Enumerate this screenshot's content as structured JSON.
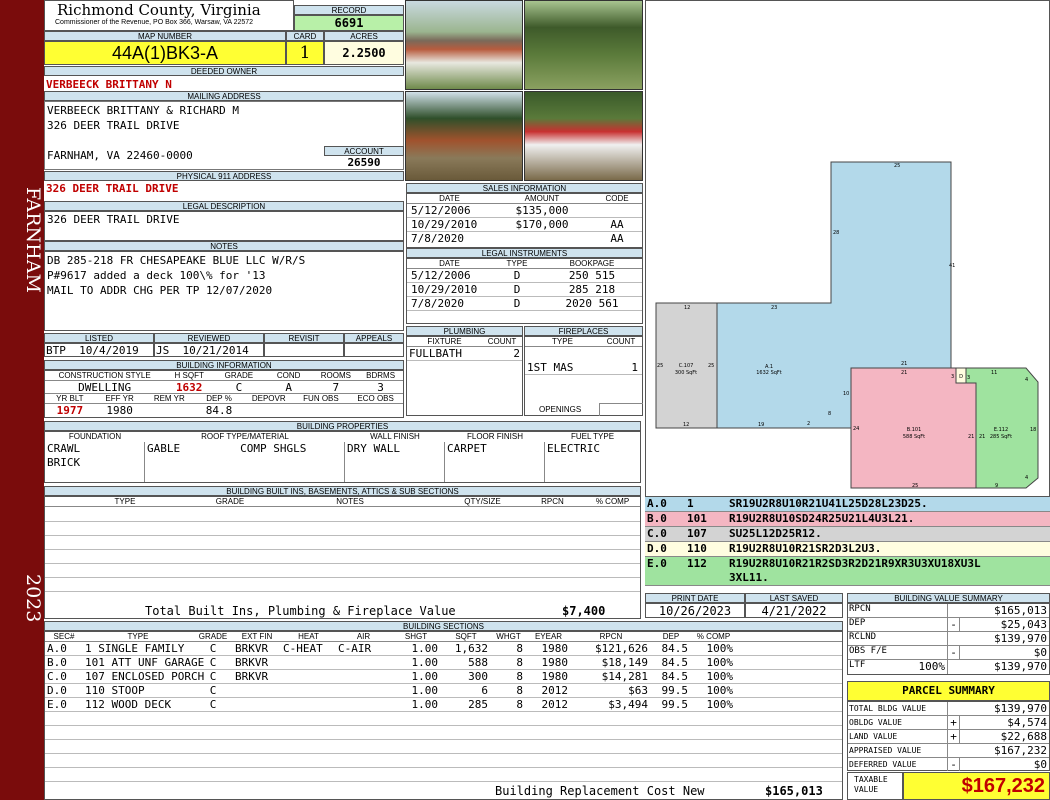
{
  "sidebar": {
    "city": "FARNHAM",
    "year": "2023"
  },
  "header": {
    "county": "Richmond County, Virginia",
    "commissioner": "Commissioner of the Revenue, PO Box 366, Warsaw, VA 22572",
    "record_label": "RECORD",
    "record": "6691",
    "map_label": "MAP NUMBER",
    "map_number": "44A(1)BK3-A",
    "card_label": "CARD",
    "card": "1",
    "acres_label": "ACRES",
    "acres": "2.2500"
  },
  "owner": {
    "deeded_label": "DEEDED OWNER",
    "deeded": "VERBEECK BRITTANY N",
    "mailing_label": "MAILING ADDRESS",
    "mail1": "VERBEECK BRITTANY & RICHARD M",
    "mail2": "326 DEER TRAIL DRIVE",
    "mail3": "FARNHAM, VA 22460-0000",
    "account_label": "ACCOUNT",
    "account": "26590",
    "physical_label": "PHYSICAL 911 ADDRESS",
    "physical": "326 DEER TRAIL DRIVE",
    "legal_label": "LEGAL DESCRIPTION",
    "legal": "326 DEER TRAIL DRIVE",
    "notes_label": "NOTES",
    "note1": "DB 285-218 FR CHESAPEAKE BLUE LLC W/R/S",
    "note2": "P#9617 added a deck 100\\% for '13",
    "note3": "MAIL TO ADDR CHG PER TP 12/07/2020"
  },
  "sales": {
    "title": "SALES INFORMATION",
    "cols": [
      "DATE",
      "AMOUNT",
      "CODE"
    ],
    "rows": [
      [
        "5/12/2006",
        "$135,000",
        ""
      ],
      [
        "10/29/2010",
        "$170,000",
        "AA"
      ],
      [
        "7/8/2020",
        "",
        "AA"
      ]
    ]
  },
  "legal_inst": {
    "title": "LEGAL INSTRUMENTS",
    "cols": [
      "DATE",
      "TYPE",
      "BOOKPAGE"
    ],
    "rows": [
      [
        "5/12/2006",
        "D",
        "250 515"
      ],
      [
        "10/29/2010",
        "D",
        "285 218"
      ],
      [
        "7/8/2020",
        "D",
        "2020 561"
      ]
    ]
  },
  "listing": {
    "listed_label": "LISTED",
    "listed_by": "BTP",
    "listed_date": "10/4/2019",
    "reviewed_label": "REVIEWED",
    "reviewed_by": "JS",
    "reviewed_date": "10/21/2014",
    "revisit_label": "REVISIT",
    "appeals_label": "APPEALS"
  },
  "bldg_info": {
    "title": "BUILDING INFORMATION",
    "h1": "CONSTRUCTION STYLE",
    "h2": "H SQFT",
    "h3": "GRADE",
    "h4": "COND",
    "h5": "ROOMS",
    "h6": "BDRMS",
    "style": "DWELLING",
    "sqft": "1632",
    "grade": "C",
    "cond": "A",
    "rooms": "7",
    "bdrms": "3",
    "h7": "YR BLT",
    "h8": "EFF YR",
    "h9": "REM YR",
    "h10": "DEP %",
    "h11": "DEPOVR",
    "h12": "FUN OBS",
    "h13": "ECO OBS",
    "yrblt": "1977",
    "effyr": "1980",
    "dep": "84.8"
  },
  "plumbing": {
    "title": "PLUMBING",
    "cols": [
      "FIXTURE",
      "COUNT"
    ],
    "fixture": "FULLBATH",
    "count": "2"
  },
  "fireplaces": {
    "title": "FIREPLACES",
    "cols": [
      "TYPE",
      "COUNT"
    ],
    "type": "1ST MAS",
    "count": "1",
    "openings": "OPENINGS"
  },
  "props": {
    "title": "BUILDING PROPERTIES",
    "cols": [
      "FOUNDATION",
      "ROOF TYPE/MATERIAL",
      "WALL FINISH",
      "FLOOR FINISH",
      "FUEL TYPE"
    ],
    "foundation1": "CRAWL",
    "foundation2": "BRICK",
    "roof1": "GABLE",
    "roof2": "COMP SHGLS",
    "wall": "DRY WALL",
    "floor": "CARPET",
    "fuel": "ELECTRIC"
  },
  "builtins": {
    "title": "BUILDING BUILT INS, BASEMENTS, ATTICS & SUB SECTIONS",
    "cols": [
      "TYPE",
      "GRADE",
      "NOTES",
      "QTY/SIZE",
      "RPCN",
      "% COMP"
    ],
    "total_label": "Total Built Ins, Plumbing & Fireplace Value",
    "total": "$7,400"
  },
  "dates": {
    "print_label": "PRINT DATE",
    "print": "10/26/2023",
    "saved_label": "LAST SAVED",
    "saved": "4/21/2022"
  },
  "sections": {
    "title": "BUILDING SECTIONS",
    "cols": [
      "SEC#",
      "TYPE",
      "GRADE",
      "EXT FIN",
      "HEAT",
      "AIR",
      "SHGT",
      "SQFT",
      "WHGT",
      "EYEAR",
      "RPCN",
      "DEP",
      "% COMP"
    ],
    "rows": [
      [
        "A.0",
        "1 SINGLE FAMILY",
        "C",
        "BRKVR",
        "C-HEAT",
        "C-AIR",
        "1.00",
        "1,632",
        "8",
        "1980",
        "$121,626",
        "84.5",
        "100%"
      ],
      [
        "B.0",
        "101 ATT UNF GARAGE",
        "C",
        "BRKVR",
        "",
        "",
        "1.00",
        "588",
        "8",
        "1980",
        "$18,149",
        "84.5",
        "100%"
      ],
      [
        "C.0",
        "107 ENCLOSED PORCH",
        "C",
        "BRKVR",
        "",
        "",
        "1.00",
        "300",
        "8",
        "1980",
        "$14,281",
        "84.5",
        "100%"
      ],
      [
        "D.0",
        "110 STOOP",
        "C",
        "",
        "",
        "",
        "1.00",
        "6",
        "8",
        "2012",
        "$63",
        "99.5",
        "100%"
      ],
      [
        "E.0",
        "112 WOOD DECK",
        "C",
        "",
        "",
        "",
        "1.00",
        "285",
        "8",
        "2012",
        "$3,494",
        "99.5",
        "100%"
      ]
    ],
    "replacement_label": "Building Replacement Cost New",
    "replacement": "$165,013"
  },
  "sketch": {
    "a_label": "A.1",
    "a_sqft": "1632 SqFt",
    "b_label": "B.101",
    "b_sqft": "588 SqFt",
    "c_label": "C.107",
    "c_sqft": "300 SqFt",
    "d_label": "D",
    "e_label": "E.112",
    "e_sqft": "285 SqFt",
    "dims": [
      "25",
      "28",
      "41",
      "12",
      "23",
      "25",
      "25",
      "21",
      "21",
      "3",
      "3",
      "11",
      "4",
      "10",
      "24",
      "8",
      "19",
      "2",
      "12",
      "21",
      "21",
      "18",
      "25",
      "9",
      "4"
    ],
    "color_a": "#b3d9ea",
    "color_b": "#f4b6c2",
    "color_c": "#d3d3d3",
    "color_d": "#fffde0",
    "color_e": "#9fe39f"
  },
  "legend": [
    {
      "sec": "A.0",
      "code": "1",
      "desc": "SR19U2R8U10R21U41L25D28L23D25.",
      "color": "#b3d9ea"
    },
    {
      "sec": "B.0",
      "code": "101",
      "desc": "R19U2R8U10SD24R25U21L4U3L21.",
      "color": "#f4b6c2"
    },
    {
      "sec": "C.0",
      "code": "107",
      "desc": "SU25L12D25R12.",
      "color": "#d3d3d3"
    },
    {
      "sec": "D.0",
      "code": "110",
      "desc": "R19U2R8U10R21SR2D3L2U3.",
      "color": "#fffde0"
    },
    {
      "sec": "E.0",
      "code": "112",
      "desc": "R19U2R8U10R21R2SD3R2D21R9XR3U3XU18XU3L",
      "desc2": "3XL11.",
      "color": "#9fe39f"
    }
  ],
  "bvs": {
    "title": "BUILDING VALUE SUMMARY",
    "rpcn_label": "RPCN",
    "rpcn": "$165,013",
    "dep_label": "DEP",
    "dep_sign": "-",
    "dep": "$25,043",
    "rclnd_label": "RCLND",
    "rclnd": "$139,970",
    "obs_label": "OBS F/E",
    "obs_sign": "-",
    "obs": "$0",
    "ltf_label": "LTF",
    "ltf_pct": "100%",
    "ltf": "$139,970"
  },
  "parcel": {
    "title": "PARCEL SUMMARY",
    "tbv_label": "TOTAL BLDG VALUE",
    "tbv": "$139,970",
    "obldg_label": "OBLDG VALUE",
    "obldg_sign": "+",
    "obldg": "$4,574",
    "land_label": "LAND VALUE",
    "land_sign": "+",
    "land": "$22,688",
    "appr_label": "APPRAISED VALUE",
    "appr": "$167,232",
    "def_label": "DEFERRED VALUE",
    "def_sign": "-",
    "def": "$0",
    "taxable_label1": "TAXABLE",
    "taxable_label2": "VALUE",
    "taxable": "$167,232"
  }
}
